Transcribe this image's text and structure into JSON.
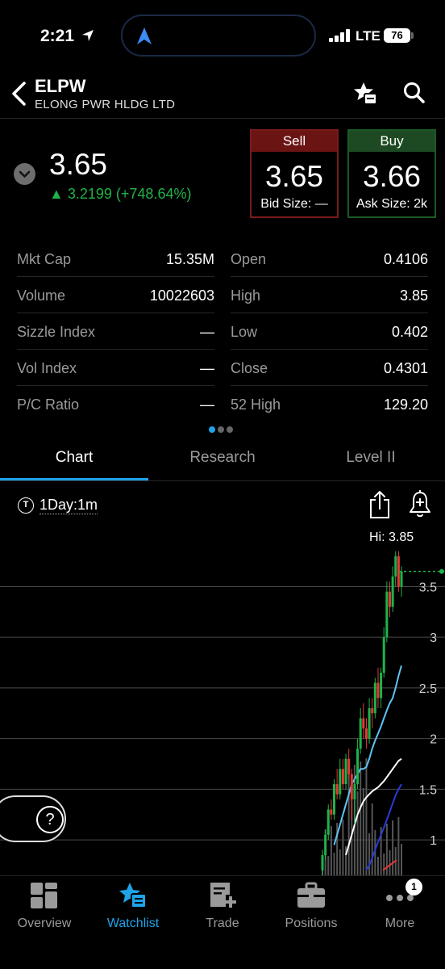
{
  "status_bar": {
    "time": "2:21",
    "carrier": "LTE",
    "battery": "76"
  },
  "header": {
    "ticker": "ELPW",
    "company": "ELONG PWR HLDG LTD"
  },
  "quote": {
    "last_price": "3.65",
    "change": "3.2199 (+748.64%)",
    "change_color": "#1fb34b",
    "sell": {
      "label": "Sell",
      "price": "3.65",
      "size": "Bid Size: —"
    },
    "buy": {
      "label": "Buy",
      "price": "3.66",
      "size": "Ask Size: 2k"
    }
  },
  "stats": {
    "left": [
      {
        "label": "Mkt Cap",
        "value": "15.35M"
      },
      {
        "label": "Volume",
        "value": "10022603"
      },
      {
        "label": "Sizzle Index",
        "value": "—"
      },
      {
        "label": "Vol Index",
        "value": "—"
      },
      {
        "label": "P/C Ratio",
        "value": "—"
      }
    ],
    "right": [
      {
        "label": "Open",
        "value": "0.4106"
      },
      {
        "label": "High",
        "value": "3.85"
      },
      {
        "label": "Low",
        "value": "0.402"
      },
      {
        "label": "Close",
        "value": "0.4301"
      },
      {
        "label": "52 High",
        "value": "129.20"
      }
    ]
  },
  "tabs": [
    {
      "label": "Chart",
      "active": true
    },
    {
      "label": "Research",
      "active": false
    },
    {
      "label": "Level II",
      "active": false
    }
  ],
  "chart_toolbar": {
    "timeframe_icon": "T",
    "timeframe": "1Day:1m",
    "hi_label": "Hi: 3.85"
  },
  "chart_data": {
    "type": "candlestick",
    "y_ticks": [
      3.5,
      3,
      2.5,
      2,
      1.5,
      1
    ],
    "y_tick_labels": [
      "3.5",
      "3",
      "2.5",
      "2",
      "1.5",
      "1"
    ],
    "ylim": [
      0.65,
      3.95
    ],
    "grid": true,
    "up_color": "#1fb34b",
    "down_color": "#e53935",
    "candles": [
      {
        "o": 0.7,
        "c": 0.85,
        "h": 0.9,
        "l": 0.65
      },
      {
        "o": 0.85,
        "c": 1.05,
        "h": 1.1,
        "l": 0.8
      },
      {
        "o": 1.05,
        "c": 1.3,
        "h": 1.35,
        "l": 1.0
      },
      {
        "o": 1.3,
        "c": 1.25,
        "h": 1.4,
        "l": 1.2
      },
      {
        "o": 1.25,
        "c": 1.55,
        "h": 1.6,
        "l": 1.2
      },
      {
        "o": 1.55,
        "c": 1.45,
        "h": 1.7,
        "l": 1.4
      },
      {
        "o": 1.45,
        "c": 1.7,
        "h": 1.8,
        "l": 1.4
      },
      {
        "o": 1.7,
        "c": 1.55,
        "h": 1.8,
        "l": 1.5
      },
      {
        "o": 1.55,
        "c": 1.8,
        "h": 1.85,
        "l": 1.5
      },
      {
        "o": 1.8,
        "c": 1.65,
        "h": 1.9,
        "l": 1.6
      },
      {
        "o": 1.65,
        "c": 1.4,
        "h": 1.7,
        "l": 1.2
      },
      {
        "o": 1.4,
        "c": 1.55,
        "h": 1.6,
        "l": 1.15
      },
      {
        "o": 1.55,
        "c": 1.9,
        "h": 2.0,
        "l": 1.5
      },
      {
        "o": 1.9,
        "c": 2.2,
        "h": 2.3,
        "l": 1.85
      },
      {
        "o": 2.2,
        "c": 2.1,
        "h": 2.35,
        "l": 2.0
      },
      {
        "o": 2.1,
        "c": 2.0,
        "h": 2.2,
        "l": 1.9
      },
      {
        "o": 2.0,
        "c": 2.3,
        "h": 2.4,
        "l": 1.95
      },
      {
        "o": 2.3,
        "c": 2.25,
        "h": 2.4,
        "l": 2.1
      },
      {
        "o": 2.25,
        "c": 2.55,
        "h": 2.6,
        "l": 2.2
      },
      {
        "o": 2.55,
        "c": 2.4,
        "h": 2.7,
        "l": 2.3
      },
      {
        "o": 2.4,
        "c": 2.65,
        "h": 2.7,
        "l": 2.3
      },
      {
        "o": 2.65,
        "c": 3.0,
        "h": 3.1,
        "l": 2.6
      },
      {
        "o": 3.0,
        "c": 3.45,
        "h": 3.55,
        "l": 2.95
      },
      {
        "o": 3.45,
        "c": 3.3,
        "h": 3.55,
        "l": 3.2
      },
      {
        "o": 3.3,
        "c": 3.6,
        "h": 3.7,
        "l": 3.25
      },
      {
        "o": 3.6,
        "c": 3.8,
        "h": 3.85,
        "l": 3.5
      },
      {
        "o": 3.8,
        "c": 3.5,
        "h": 3.85,
        "l": 3.45
      },
      {
        "o": 3.5,
        "c": 3.65,
        "h": 3.7,
        "l": 3.4
      }
    ],
    "ma_fast": [
      0.95,
      1.05,
      1.15,
      1.25,
      1.35,
      1.45,
      1.55,
      1.6,
      1.65,
      1.7,
      1.7,
      1.72,
      1.8,
      1.9,
      1.98,
      2.05,
      2.12,
      2.2,
      2.28,
      2.35,
      2.4,
      2.5,
      2.62,
      2.72
    ],
    "ma_mid": [
      0.85,
      0.95,
      1.05,
      1.15,
      1.25,
      1.32,
      1.38,
      1.42,
      1.45,
      1.48,
      1.5,
      1.52,
      1.55,
      1.58,
      1.62,
      1.66,
      1.7,
      1.74,
      1.78,
      1.8
    ],
    "ma_slow": [
      0.7,
      0.75,
      0.82,
      0.9,
      0.98,
      1.05,
      1.12,
      1.2,
      1.28,
      1.36,
      1.44,
      1.5,
      1.55
    ],
    "last_price_line": 3.65
  },
  "bottom_nav": [
    {
      "label": "Overview",
      "icon": "grid-icon",
      "active": false
    },
    {
      "label": "Watchlist",
      "icon": "star-list-icon",
      "active": true
    },
    {
      "label": "Trade",
      "icon": "trade-ticket-icon",
      "active": false
    },
    {
      "label": "Positions",
      "icon": "briefcase-icon",
      "active": false
    },
    {
      "label": "More",
      "icon": "more-dots-icon",
      "active": false
    }
  ],
  "more_badge": "1",
  "help_label": "?"
}
